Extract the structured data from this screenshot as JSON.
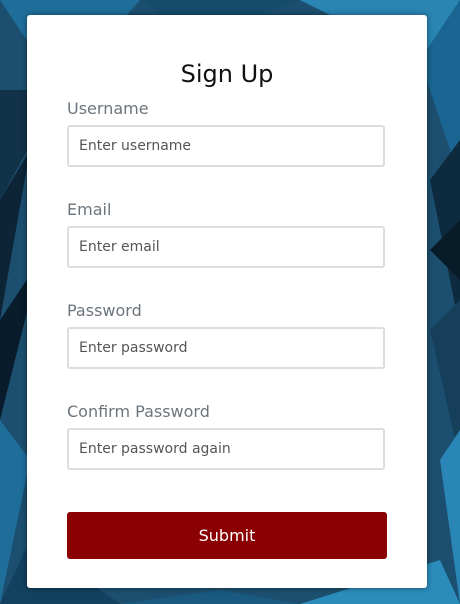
{
  "form": {
    "title": "Sign Up",
    "fields": [
      {
        "label": "Username",
        "placeholder": "Enter username",
        "value": ""
      },
      {
        "label": "Email",
        "placeholder": "Enter email",
        "value": ""
      },
      {
        "label": "Password",
        "placeholder": "Enter password",
        "value": ""
      },
      {
        "label": "Confirm Password",
        "placeholder": "Enter password again",
        "value": ""
      }
    ],
    "submit_label": "Submit"
  },
  "colors": {
    "submit_background": "#8b0000",
    "background_dark": "#0a2233",
    "background_light": "#2a8ab8"
  }
}
